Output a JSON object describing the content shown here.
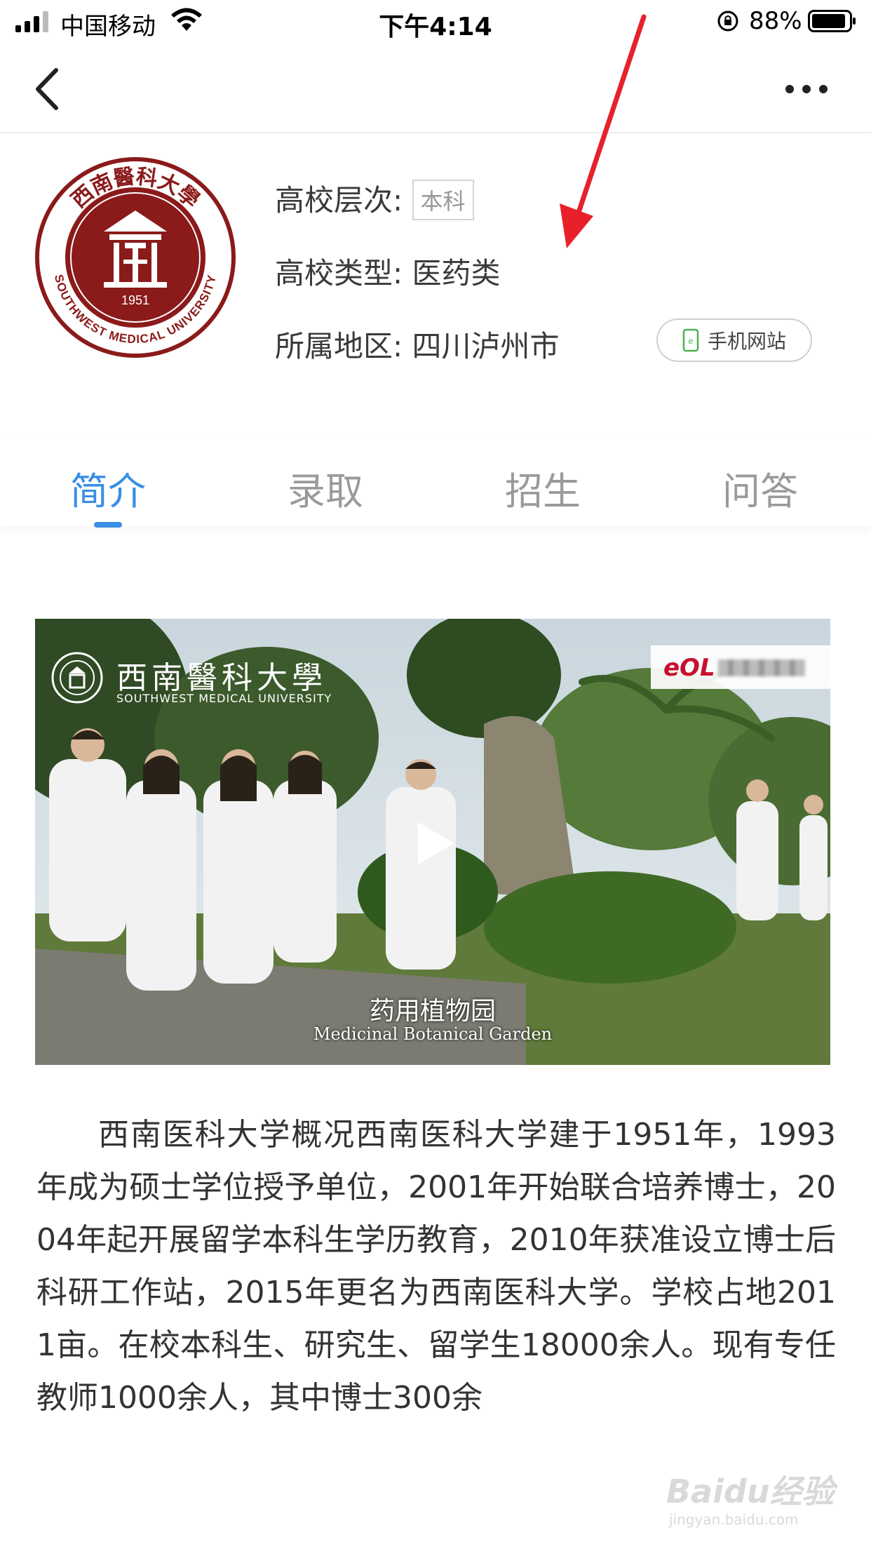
{
  "status_bar": {
    "carrier": "中国移动",
    "time": "下午4:14",
    "battery": "88%"
  },
  "university": {
    "name_cn": "西南醫科大學",
    "name_en": "SOUTHWEST MEDICAL UNIVERSITY",
    "founded": "1951",
    "level_label": "高校层次:",
    "level_value": "本科",
    "type_label": "高校类型:",
    "type_value": "医药类",
    "region_label": "所属地区:",
    "region_value": "四川泸州市",
    "mobile_site": "手机网站"
  },
  "tabs": [
    {
      "label": "简介",
      "active": true
    },
    {
      "label": "录取",
      "active": false
    },
    {
      "label": "招生",
      "active": false
    },
    {
      "label": "问答",
      "active": false
    }
  ],
  "video": {
    "overlay_title": "西南醫科大學",
    "overlay_subtitle": "SOUTHWEST MEDICAL UNIVERSITY",
    "eol_logo": "eOL",
    "caption_cn": "药用植物园",
    "caption_en": "Medicinal Botanical Garden"
  },
  "intro_text": "西南医科大学概况西南医科大学建于1951年，1993年成为硕士学位授予单位，2001年开始联合培养博士，2004年起开展留学本科生学历教育，2010年获准设立博士后科研工作站，2015年更名为西南医科大学。学校占地2011亩。在校本科生、研究生、留学生18000余人。现有专任教师1000余人，其中博士300余",
  "watermark": {
    "brand": "Baidu经验",
    "url": "jingyan.baidu.com"
  },
  "colors": {
    "accent": "#3a8ee6",
    "logo_red": "#8b1a1a",
    "annotation_red": "#e8202a"
  }
}
